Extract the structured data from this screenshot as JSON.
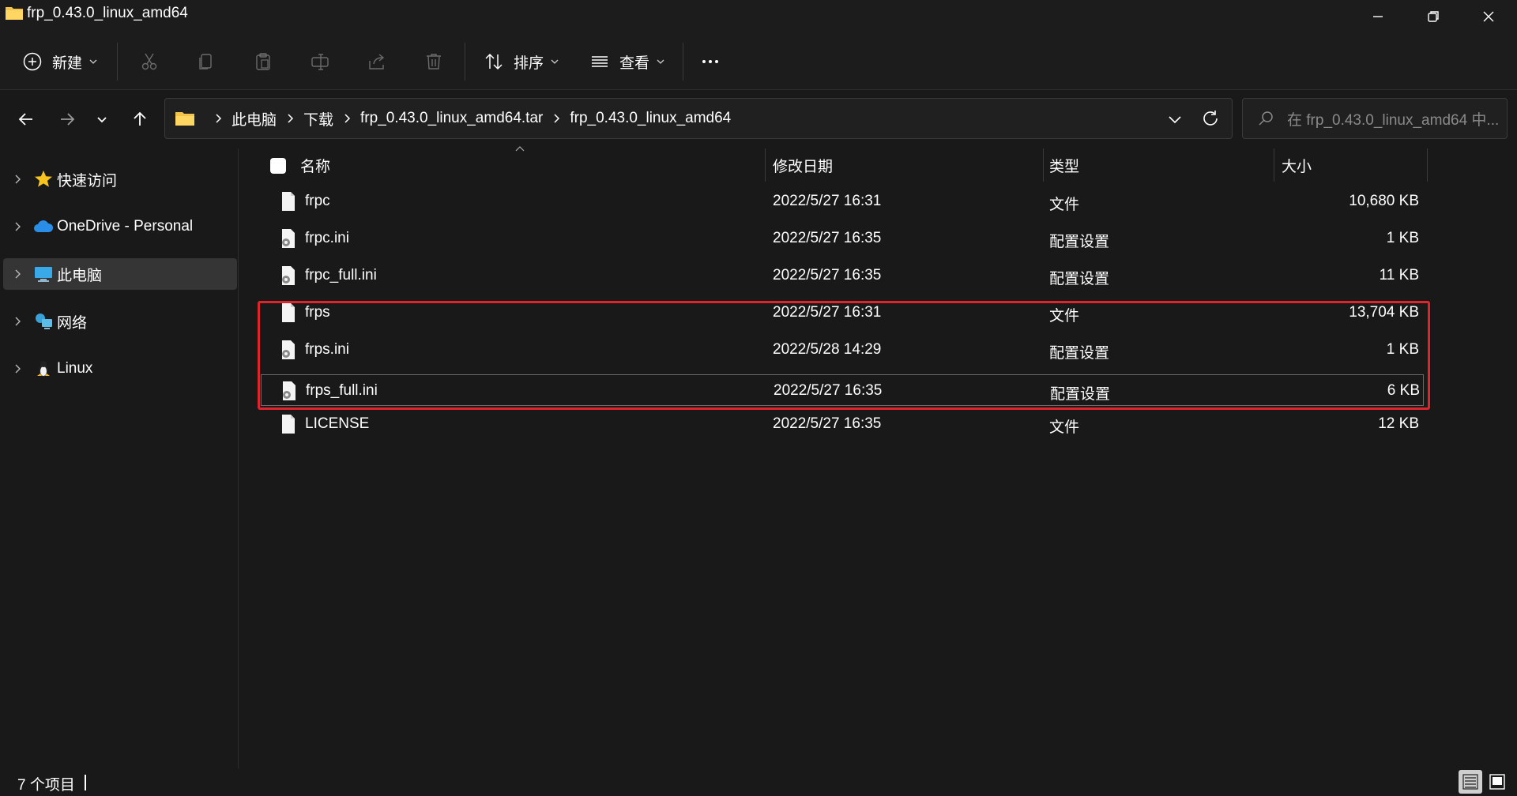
{
  "window": {
    "title": "frp_0.43.0_linux_amd64"
  },
  "toolbar": {
    "new_label": "新建",
    "sort_label": "排序",
    "view_label": "查看",
    "icons": [
      "cut-icon",
      "copy-icon",
      "paste-icon",
      "rename-icon",
      "share-icon",
      "delete-icon"
    ]
  },
  "address": {
    "crumbs": [
      "此电脑",
      "下载",
      "frp_0.43.0_linux_amd64.tar",
      "frp_0.43.0_linux_amd64"
    ]
  },
  "search": {
    "placeholder": "在 frp_0.43.0_linux_amd64 中..."
  },
  "sidebar": {
    "items": [
      {
        "label": "快速访问",
        "icon": "star-icon",
        "selected": false
      },
      {
        "label": "OneDrive - Personal",
        "icon": "cloud-icon",
        "selected": false
      },
      {
        "label": "此电脑",
        "icon": "computer-icon",
        "selected": true
      },
      {
        "label": "网络",
        "icon": "network-icon",
        "selected": false
      },
      {
        "label": "Linux",
        "icon": "linux-icon",
        "selected": false
      }
    ]
  },
  "columns": {
    "name": "名称",
    "date": "修改日期",
    "type": "类型",
    "size": "大小"
  },
  "files": [
    {
      "name": "frpc",
      "date": "2022/5/27 16:31",
      "type": "文件",
      "size": "10,680 KB",
      "icon": "file-icon"
    },
    {
      "name": "frpc.ini",
      "date": "2022/5/27 16:35",
      "type": "配置设置",
      "size": "1 KB",
      "icon": "config-file-icon"
    },
    {
      "name": "frpc_full.ini",
      "date": "2022/5/27 16:35",
      "type": "配置设置",
      "size": "11 KB",
      "icon": "config-file-icon"
    },
    {
      "name": "frps",
      "date": "2022/5/27 16:31",
      "type": "文件",
      "size": "13,704 KB",
      "icon": "file-icon"
    },
    {
      "name": "frps.ini",
      "date": "2022/5/28 14:29",
      "type": "配置设置",
      "size": "1 KB",
      "icon": "config-file-icon"
    },
    {
      "name": "frps_full.ini",
      "date": "2022/5/27 16:35",
      "type": "配置设置",
      "size": "6 KB",
      "icon": "config-file-icon"
    },
    {
      "name": "LICENSE",
      "date": "2022/5/27 16:35",
      "type": "文件",
      "size": "12 KB",
      "icon": "file-icon"
    }
  ],
  "status": {
    "count": "7 个项目"
  },
  "colors": {
    "background": "#191919",
    "highlight": "#e0242b",
    "selected": "#353535"
  }
}
